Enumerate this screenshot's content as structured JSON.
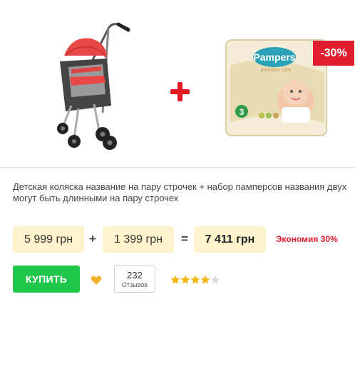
{
  "product": {
    "title": "Детская коляска название на пару строчек + набор памперсов названия двух могут быть длинными на пару строчек",
    "discount_badge": "-30%",
    "brand_text": "Pampers",
    "brand_subtext": "premium care",
    "pack_size": "3"
  },
  "pricing": {
    "price_1": "5 999 грн",
    "plus_op": "+",
    "price_2": "1 399 грн",
    "equals_op": "=",
    "total": "7 411 грн",
    "savings": "Экономия 30%"
  },
  "actions": {
    "buy_label": "КУПИТЬ",
    "reviews_count": "232",
    "reviews_label": "Отзывов",
    "rating": 4,
    "rating_max": 5
  },
  "colors": {
    "accent_red": "#e01e2f",
    "buy_green": "#1fc64a",
    "price_bg": "#fdf3cc",
    "star_gold": "#f5b50a",
    "heart_gold": "#f0b52c"
  }
}
